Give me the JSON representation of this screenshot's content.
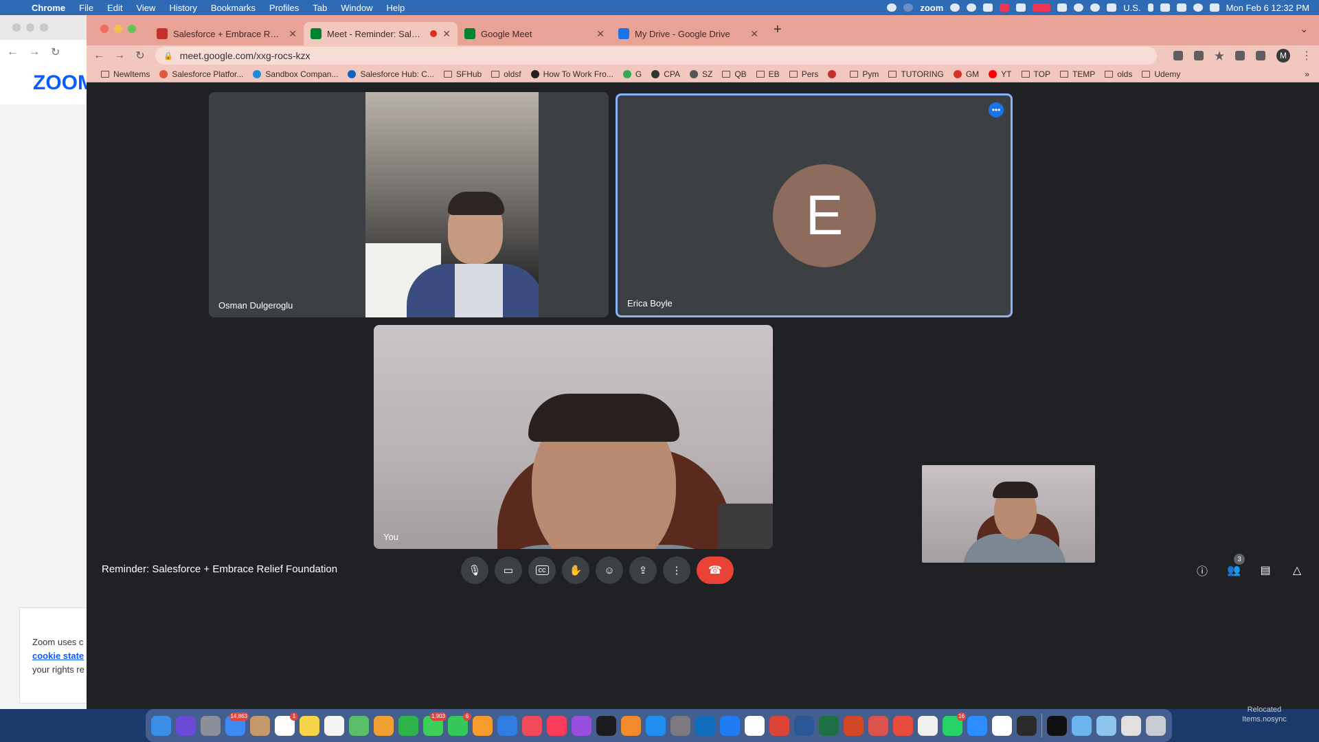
{
  "menubar": {
    "app": "Chrome",
    "items": [
      "File",
      "Edit",
      "View",
      "History",
      "Bookmarks",
      "Profiles",
      "Tab",
      "Window",
      "Help"
    ],
    "status_zoom": "zoom",
    "input_source": "U.S.",
    "clock": "Mon Feb 6  12:32 PM"
  },
  "zoom_bg": {
    "logo": "zoom",
    "cookie_text_1": "Zoom uses c",
    "cookie_link": "cookie state",
    "cookie_text_2": "your rights re"
  },
  "chrome": {
    "tabs": [
      {
        "title": "Salesforce + Embrace Relief Fo",
        "favicon_color": "#c4302b"
      },
      {
        "title": "Meet - Reminder: Salesforce",
        "favicon_color": "#00832d"
      },
      {
        "title": "Google Meet",
        "favicon_color": "#00832d"
      },
      {
        "title": "My Drive - Google Drive",
        "favicon_color": "#1a73e8"
      }
    ],
    "url": "meet.google.com/xxg-rocs-kzx",
    "profile_initial": "M",
    "bookmarks": [
      {
        "label": "NewItems",
        "icon": "folder"
      },
      {
        "label": "Salesforce Platfor...",
        "icon": "site",
        "color": "#e2563b"
      },
      {
        "label": "Sandbox Compan...",
        "icon": "site",
        "color": "#1f8ad6"
      },
      {
        "label": "Salesforce Hub: C...",
        "icon": "site",
        "color": "#0a66c2"
      },
      {
        "label": "SFHub",
        "icon": "folder"
      },
      {
        "label": "oldsf",
        "icon": "folder"
      },
      {
        "label": "How To Work Fro...",
        "icon": "site",
        "color": "#222222"
      },
      {
        "label": "G",
        "icon": "site",
        "color": "#34a853"
      },
      {
        "label": "CPA",
        "icon": "site",
        "color": "#333333"
      },
      {
        "label": "SZ",
        "icon": "site",
        "color": "#555555"
      },
      {
        "label": "QB",
        "icon": "folder"
      },
      {
        "label": "EB",
        "icon": "folder"
      },
      {
        "label": "Pers",
        "icon": "folder"
      },
      {
        "label": "",
        "icon": "site",
        "color": "#c4302b"
      },
      {
        "label": "Pym",
        "icon": "folder"
      },
      {
        "label": "TUTORING",
        "icon": "folder"
      },
      {
        "label": "GM",
        "icon": "site",
        "color": "#d93025"
      },
      {
        "label": "YT",
        "icon": "site",
        "color": "#ff0000"
      },
      {
        "label": "TOP",
        "icon": "folder"
      },
      {
        "label": "TEMP",
        "icon": "folder"
      },
      {
        "label": "olds",
        "icon": "folder"
      },
      {
        "label": "Udemy",
        "icon": "folder"
      }
    ],
    "bookmarks_more": "»"
  },
  "meet": {
    "participants": [
      {
        "name": "Osman Dulgeroglu"
      },
      {
        "name": "Erica Boyle",
        "initial": "E"
      },
      {
        "name": "You"
      }
    ],
    "meeting_title": "Reminder: Salesforce + Embrace Relief Foundation",
    "people_count": "3"
  },
  "dock": {
    "apps": [
      {
        "name": "finder",
        "color": "#3a8ee6"
      },
      {
        "name": "siri",
        "color": "#6b4bd6"
      },
      {
        "name": "launchpad",
        "color": "#8a8f99"
      },
      {
        "name": "mail",
        "color": "#3d8bf2",
        "badge": "14,863"
      },
      {
        "name": "contacts",
        "color": "#c49a6c"
      },
      {
        "name": "calendar",
        "color": "#ffffff",
        "badge": "1"
      },
      {
        "name": "notes",
        "color": "#f7d54a"
      },
      {
        "name": "reminders",
        "color": "#f5f5f5"
      },
      {
        "name": "maps",
        "color": "#5bbf6a"
      },
      {
        "name": "photos",
        "color": "#f0a030"
      },
      {
        "name": "numbers",
        "color": "#2db34a"
      },
      {
        "name": "messages",
        "color": "#3ecf5a",
        "badge": "1,903"
      },
      {
        "name": "facetime",
        "color": "#34c759",
        "badge": "6"
      },
      {
        "name": "pages",
        "color": "#f79b2e"
      },
      {
        "name": "keynote",
        "color": "#2f7de1"
      },
      {
        "name": "news",
        "color": "#f04a5a"
      },
      {
        "name": "music",
        "color": "#fa3c5a"
      },
      {
        "name": "podcasts",
        "color": "#9a4ee0"
      },
      {
        "name": "tv",
        "color": "#1c1c1e"
      },
      {
        "name": "books",
        "color": "#f28a2e"
      },
      {
        "name": "app-store",
        "color": "#1e8ef0"
      },
      {
        "name": "system-preferences",
        "color": "#7a7a80"
      },
      {
        "name": "outlook",
        "color": "#0f6cbd"
      },
      {
        "name": "messenger",
        "color": "#1f7cf2"
      },
      {
        "name": "slack",
        "color": "#ffffff"
      },
      {
        "name": "chrome",
        "color": "#db4437"
      },
      {
        "name": "word",
        "color": "#2b5797"
      },
      {
        "name": "excel",
        "color": "#1d7044"
      },
      {
        "name": "powerpoint",
        "color": "#d24726"
      },
      {
        "name": "remote-desktop",
        "color": "#d9534f"
      },
      {
        "name": "app-red",
        "color": "#e84a3c"
      },
      {
        "name": "textedit",
        "color": "#f0f0f0"
      },
      {
        "name": "whatsapp",
        "color": "#25d366",
        "badge": "16"
      },
      {
        "name": "zoom",
        "color": "#2d8cff"
      },
      {
        "name": "app-multicolor",
        "color": "#ffffff"
      },
      {
        "name": "app-dark",
        "color": "#2a2a2a"
      },
      {
        "name": "terminal",
        "color": "#111111"
      },
      {
        "name": "folder-downloads",
        "color": "#6cb4ee"
      },
      {
        "name": "folder-stack",
        "color": "#8ec5f0"
      },
      {
        "name": "files-preview",
        "color": "#e0e0e0"
      },
      {
        "name": "trash",
        "color": "#c8ccd2"
      }
    ]
  },
  "desktop": {
    "line1": "Relocated",
    "line2": "Items.nosync"
  }
}
